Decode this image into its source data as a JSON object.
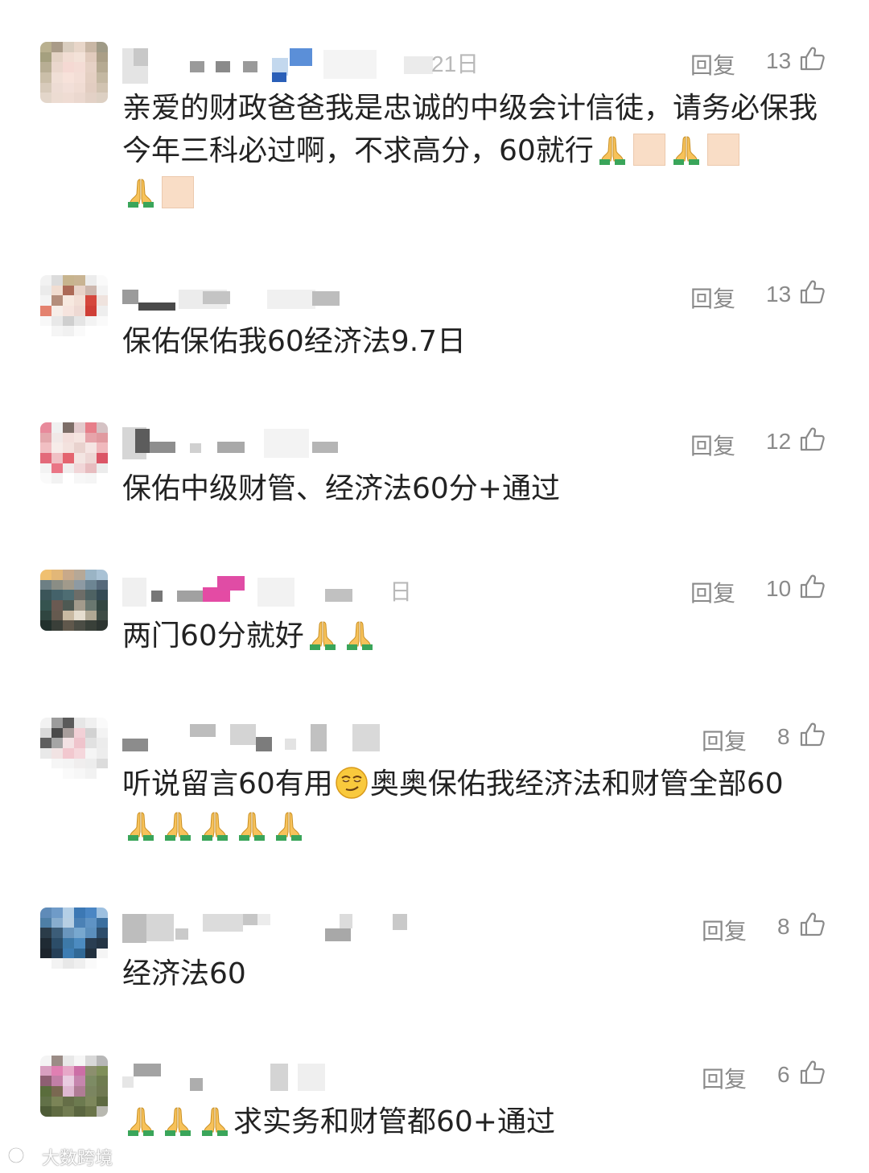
{
  "comments": [
    {
      "date_partial": "21日",
      "reply_label": "回复",
      "likes": "13",
      "text_parts": [
        "亲爱的财政爸爸我是忠诚的中级会计信徒，请务必保我今年三科必过啊，不求高分，60就行"
      ],
      "emoji_sequence": [
        "pray",
        "square",
        "pray",
        "square",
        "pray",
        "square"
      ]
    },
    {
      "reply_label": "回复",
      "likes": "13",
      "text_parts": [
        "保佑保佑我60经济法9.7日"
      ]
    },
    {
      "reply_label": "回复",
      "likes": "12",
      "text_parts": [
        "保佑中级财管、经济法60分+通过"
      ]
    },
    {
      "date_partial": "日",
      "reply_label": "回复",
      "likes": "10",
      "text_parts": [
        "两门60分就好"
      ],
      "emoji_sequence": [
        "pray",
        "pray"
      ]
    },
    {
      "reply_label": "回复",
      "likes": "8",
      "text_parts": [
        "听说留言60有用",
        "奥奥保佑我经济法和财管全部60"
      ],
      "emoji_sequence": [
        "smirk",
        "pray",
        "pray",
        "pray",
        "pray",
        "pray"
      ]
    },
    {
      "reply_label": "回复",
      "likes": "8",
      "text_parts": [
        "经济法60"
      ]
    },
    {
      "reply_label": "回复",
      "likes": "6",
      "text_parts": [
        "求实务和财管都60+通过"
      ],
      "emoji_sequence": [
        "pray",
        "pray",
        "pray"
      ]
    }
  ],
  "watermark": {
    "text": "大数跨境"
  },
  "icons": {
    "like": "thumbs-up-icon",
    "pray": "folded-hands-emoji",
    "smirk": "smirking-face-emoji"
  },
  "colors": {
    "text": "#222222",
    "meta": "#8a8a8a",
    "skin_square": "#f9ddc6"
  }
}
